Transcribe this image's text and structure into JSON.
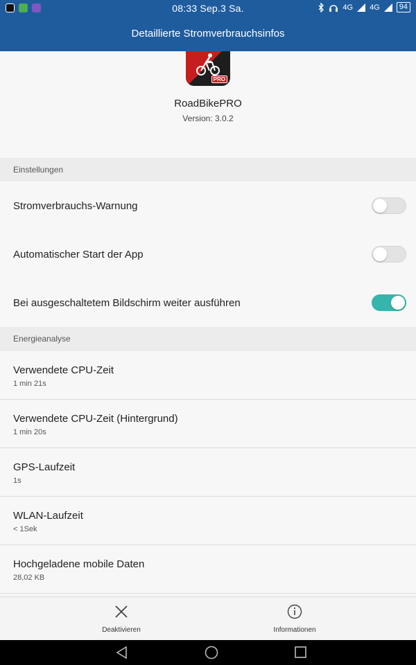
{
  "status_bar": {
    "time": "08:33 Sep.3 Sa.",
    "network_1": "4G",
    "network_2": "4G",
    "battery": "94",
    "left_icons": [
      "video-icon",
      "whatsapp-icon",
      "notification-icon"
    ],
    "right_icons": [
      "bluetooth-icon",
      "headset-icon",
      "signal-icon"
    ]
  },
  "app_bar": {
    "title": "Detaillierte Stromverbrauchsinfos"
  },
  "app": {
    "name": "RoadBikePRO",
    "version": "Version: 3.0.2",
    "badge": "PRO"
  },
  "settings": {
    "header": "Einstellungen",
    "items": [
      {
        "label": "Stromverbrauchs-Warnung",
        "enabled": false
      },
      {
        "label": "Automatischer Start der App",
        "enabled": false
      },
      {
        "label": "Bei ausgeschaltetem Bildschirm weiter ausführen",
        "enabled": true
      }
    ]
  },
  "energy": {
    "header": "Energieanalyse",
    "items": [
      {
        "title": "Verwendete CPU-Zeit",
        "value": "1 min 21s"
      },
      {
        "title": "Verwendete CPU-Zeit (Hintergrund)",
        "value": "1 min 20s"
      },
      {
        "title": "GPS-Laufzeit",
        "value": "1s"
      },
      {
        "title": "WLAN-Laufzeit",
        "value": "< 1Sek"
      },
      {
        "title": "Hochgeladene mobile Daten",
        "value": "28,02 KB"
      }
    ]
  },
  "actions": {
    "deactivate": {
      "label": "Deaktivieren",
      "icon": "close-icon"
    },
    "info": {
      "label": "Informationen",
      "icon": "info-icon"
    }
  },
  "colors": {
    "primary": "#1f5c9e",
    "toggle_on": "#35b5ac",
    "app_icon_red": "#c61e1e"
  }
}
